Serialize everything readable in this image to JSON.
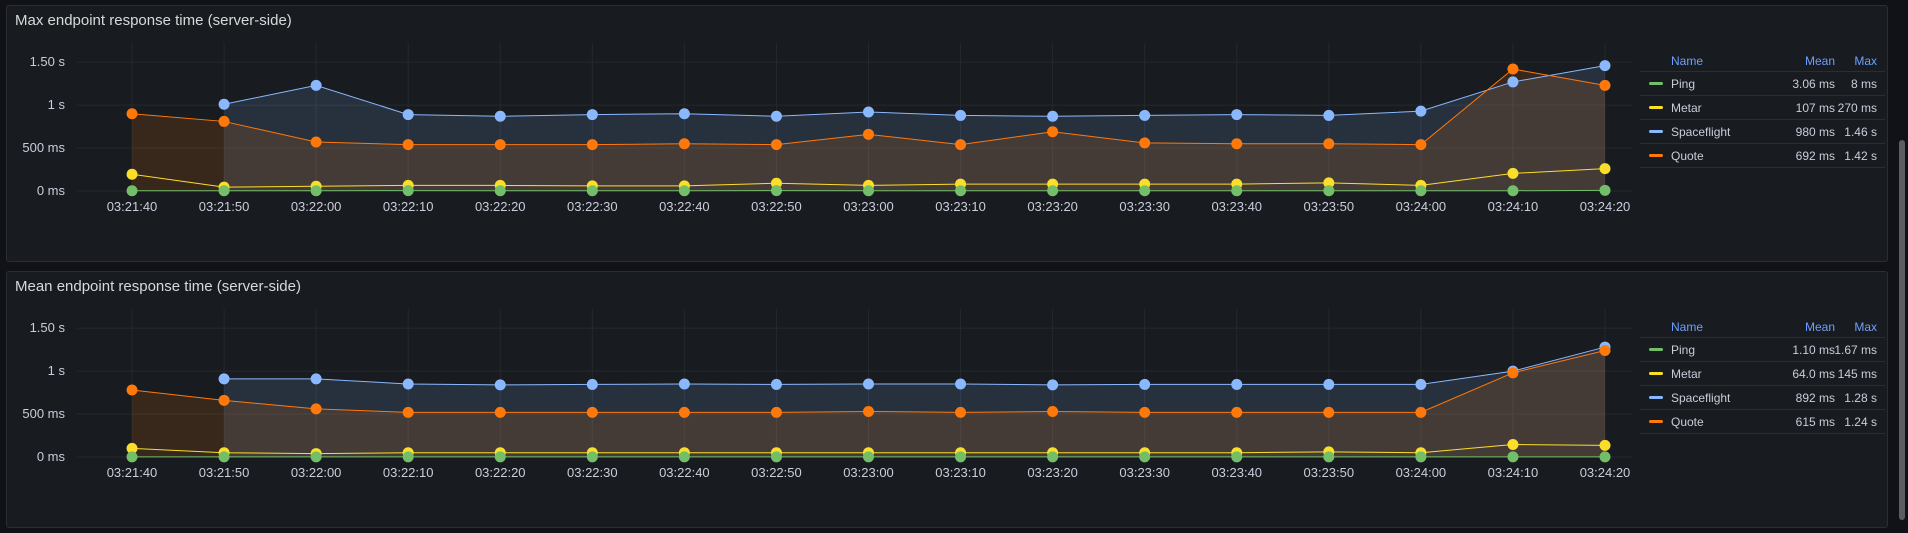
{
  "panels": [
    {
      "title": "Max endpoint response time (server-side)",
      "legend": {
        "headers": {
          "name": "Name",
          "mean": "Mean",
          "max": "Max"
        },
        "rows": [
          {
            "name": "Ping",
            "mean": "3.06 ms",
            "max": "8 ms",
            "color": "#73bf69"
          },
          {
            "name": "Metar",
            "mean": "107 ms",
            "max": "270 ms",
            "color": "#fade2a"
          },
          {
            "name": "Spaceflight",
            "mean": "980 ms",
            "max": "1.46 s",
            "color": "#8ab8ff"
          },
          {
            "name": "Quote",
            "mean": "692 ms",
            "max": "1.42 s",
            "color": "#ff780a"
          }
        ]
      },
      "chart_data": {
        "type": "line",
        "x": [
          "03:21:40",
          "03:21:50",
          "03:22:00",
          "03:22:10",
          "03:22:20",
          "03:22:30",
          "03:22:40",
          "03:22:50",
          "03:23:00",
          "03:23:10",
          "03:23:20",
          "03:23:30",
          "03:23:40",
          "03:23:50",
          "03:24:00",
          "03:24:10",
          "03:24:20"
        ],
        "y_ticks": [
          {
            "value": 0,
            "label": "0 ms"
          },
          {
            "value": 500,
            "label": "500 ms"
          },
          {
            "value": 1000,
            "label": "1 s"
          },
          {
            "value": 1500,
            "label": "1.50 s"
          }
        ],
        "ylim": [
          0,
          1700
        ],
        "ylabel": "",
        "grid": true,
        "legend_position": "right",
        "series": [
          {
            "name": "Spaceflight",
            "color": "#8ab8ff",
            "fill": true,
            "values": [
              null,
              1010,
              1230,
              890,
              870,
              890,
              900,
              870,
              920,
              880,
              870,
              880,
              890,
              880,
              930,
              1270,
              1460
            ]
          },
          {
            "name": "Quote",
            "color": "#ff780a",
            "fill": true,
            "values": [
              900,
              810,
              570,
              540,
              540,
              540,
              550,
              540,
              660,
              540,
              690,
              560,
              550,
              550,
              540,
              1420,
              1230
            ]
          },
          {
            "name": "Metar",
            "color": "#fade2a",
            "fill": false,
            "values": [
              195,
              45,
              55,
              65,
              65,
              60,
              60,
              90,
              65,
              80,
              80,
              80,
              80,
              95,
              65,
              205,
              260
            ]
          },
          {
            "name": "Ping",
            "color": "#73bf69",
            "fill": false,
            "values": [
              3,
              3,
              3,
              4,
              3,
              3,
              3,
              4,
              3,
              3,
              3,
              3,
              3,
              3,
              3,
              3,
              8
            ]
          }
        ]
      }
    },
    {
      "title": "Mean endpoint response time (server-side)",
      "legend": {
        "headers": {
          "name": "Name",
          "mean": "Mean",
          "max": "Max"
        },
        "rows": [
          {
            "name": "Ping",
            "mean": "1.10 ms",
            "max": "1.67 ms",
            "color": "#73bf69"
          },
          {
            "name": "Metar",
            "mean": "64.0 ms",
            "max": "145 ms",
            "color": "#fade2a"
          },
          {
            "name": "Spaceflight",
            "mean": "892 ms",
            "max": "1.28 s",
            "color": "#8ab8ff"
          },
          {
            "name": "Quote",
            "mean": "615 ms",
            "max": "1.24 s",
            "color": "#ff780a"
          }
        ]
      },
      "chart_data": {
        "type": "line",
        "x": [
          "03:21:40",
          "03:21:50",
          "03:22:00",
          "03:22:10",
          "03:22:20",
          "03:22:30",
          "03:22:40",
          "03:22:50",
          "03:23:00",
          "03:23:10",
          "03:23:20",
          "03:23:30",
          "03:23:40",
          "03:23:50",
          "03:24:00",
          "03:24:10",
          "03:24:20"
        ],
        "y_ticks": [
          {
            "value": 0,
            "label": "0 ms"
          },
          {
            "value": 500,
            "label": "500 ms"
          },
          {
            "value": 1000,
            "label": "1 s"
          },
          {
            "value": 1500,
            "label": "1.50 s"
          }
        ],
        "ylim": [
          0,
          1700
        ],
        "ylabel": "",
        "grid": true,
        "legend_position": "right",
        "series": [
          {
            "name": "Spaceflight",
            "color": "#8ab8ff",
            "fill": true,
            "values": [
              null,
              910,
              910,
              850,
              840,
              845,
              850,
              845,
              850,
              850,
              840,
              845,
              845,
              845,
              845,
              1000,
              1280
            ]
          },
          {
            "name": "Quote",
            "color": "#ff780a",
            "fill": true,
            "values": [
              780,
              660,
              560,
              520,
              520,
              520,
              520,
              520,
              530,
              520,
              530,
              520,
              520,
              520,
              520,
              980,
              1240
            ]
          },
          {
            "name": "Metar",
            "color": "#fade2a",
            "fill": false,
            "values": [
              100,
              50,
              40,
              50,
              50,
              50,
              50,
              50,
              50,
              50,
              50,
              50,
              50,
              60,
              50,
              145,
              135
            ]
          },
          {
            "name": "Ping",
            "color": "#73bf69",
            "fill": false,
            "values": [
              1,
              1,
              1,
              1,
              1,
              1,
              1,
              1,
              1,
              1,
              1,
              1,
              1,
              1,
              1,
              1,
              1.67
            ]
          }
        ]
      }
    }
  ]
}
